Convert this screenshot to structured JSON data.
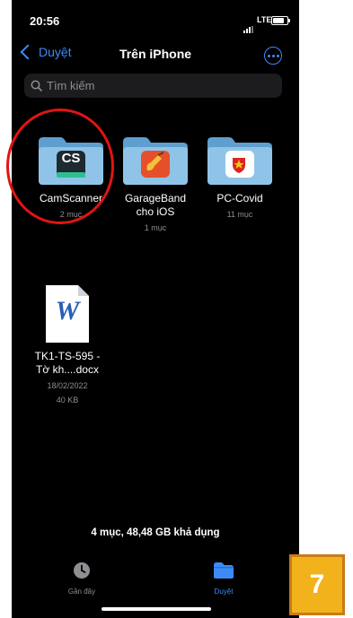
{
  "status_bar": {
    "time": "20:56",
    "network": "LTE"
  },
  "nav": {
    "back_label": "Duyệt",
    "title": "Trên iPhone"
  },
  "search": {
    "placeholder": "Tìm kiếm"
  },
  "items": [
    {
      "name": "CamScanner",
      "meta": "2 mục",
      "icon": "camscanner-app-icon"
    },
    {
      "name": "GarageBand\ncho iOS",
      "meta": "1 mục",
      "icon": "garageband-app-icon"
    },
    {
      "name": "PC-Covid",
      "meta": "11 mục",
      "icon": "pc-covid-app-icon"
    },
    {
      "name": "TK1-TS-595 -\nTờ kh....docx",
      "date": "18/02/2022",
      "size": "40 KB",
      "icon": "word-document-icon"
    }
  ],
  "camscanner_logo": "CS",
  "word_logo": "W",
  "storage_summary": "4 mục, 48,48 GB khả dụng",
  "tabs": {
    "recent": "Gần đây",
    "browse": "Duyệt"
  },
  "step_number": "7",
  "colors": {
    "accent": "#3d8bf7",
    "folder_light": "#8fc4e8",
    "folder_dark": "#5e9fcf",
    "highlight": "#e01414",
    "badge": "#f2b21b"
  }
}
